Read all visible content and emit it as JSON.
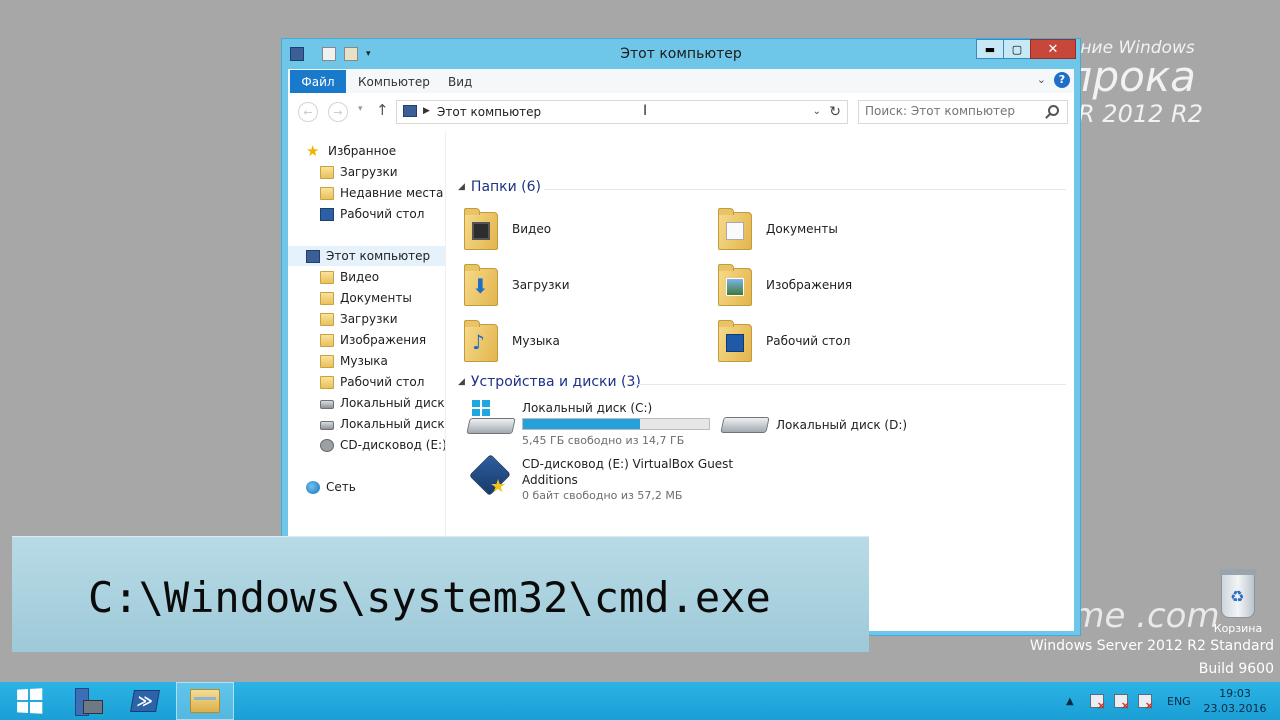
{
  "desktop": {
    "watermark_line1": "вание Windows",
    "watermark_line2": "прока",
    "watermark_line3": "R 2012 R2",
    "rufome": "Ru      Fome  .com",
    "version_line1": "Windows Server 2012 R2 Standard",
    "version_line2": "Build 9600",
    "recycle_label": "Корзина"
  },
  "window": {
    "title": "Этот компьютер",
    "close_glyph": "✕",
    "min_glyph": "▬",
    "max_glyph": "▢"
  },
  "ribbon": {
    "file_tab": "Файл",
    "computer_tab": "Компьютер",
    "view_tab": "Вид",
    "help_glyph": "?"
  },
  "address": {
    "path": "Этот компьютер"
  },
  "search": {
    "placeholder": "Поиск: Этот компьютер"
  },
  "navpane": {
    "favorites": "Избранное",
    "fav_items": [
      "Загрузки",
      "Недавние места",
      "Рабочий стол"
    ],
    "this_pc": "Этот компьютер",
    "pc_items": [
      "Видео",
      "Документы",
      "Загрузки",
      "Изображения",
      "Музыка",
      "Рабочий стол",
      "Локальный диск (C",
      "Локальный диск (D",
      "CD-дисковод (E:) Vi"
    ],
    "network": "Сеть"
  },
  "folders_group": {
    "header": "Папки (6)",
    "items": [
      "Видео",
      "Документы",
      "Загрузки",
      "Изображения",
      "Музыка",
      "Рабочий стол"
    ]
  },
  "devices_group": {
    "header": "Устройства и диски (3)",
    "drive_c": {
      "name": "Локальный диск (C:)",
      "free": "5,45 ГБ свободно из 14,7 ГБ",
      "used_fraction": 0.63
    },
    "drive_d": {
      "name": "Локальный диск (D:)"
    },
    "drive_e": {
      "name_line1": "CD-дисковод (E:) VirtualBox Guest",
      "name_line2": "Additions",
      "free": "0 байт свободно из 57,2 МБ"
    }
  },
  "banner": {
    "text": "C:\\Windows\\system32\\cmd.exe"
  },
  "taskbar": {
    "ps_glyph": "≫",
    "lang": "ENG",
    "time": "19:03",
    "date": "23.03.2016"
  }
}
